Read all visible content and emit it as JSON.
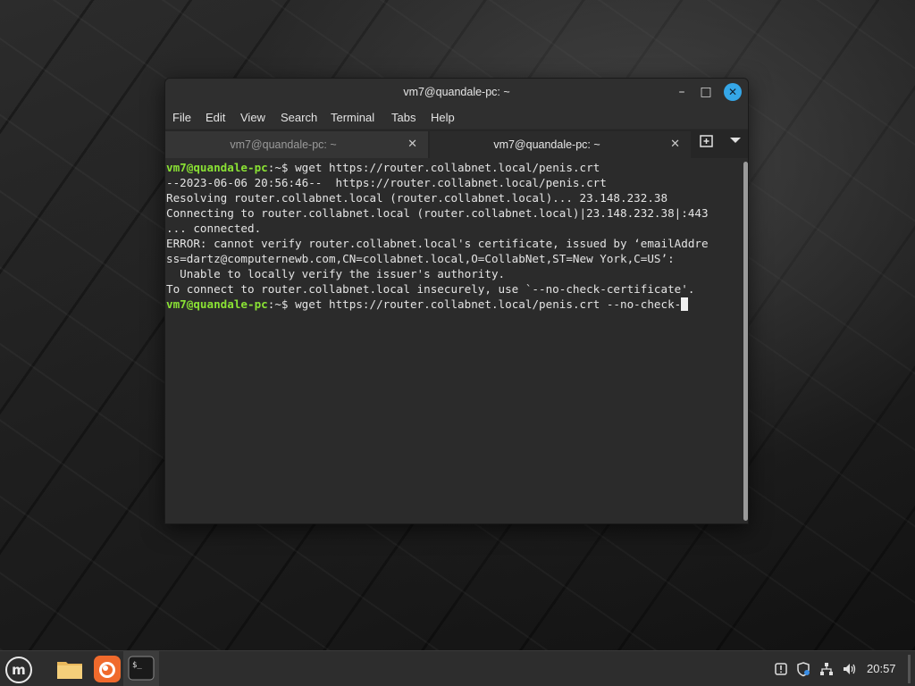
{
  "window": {
    "title": "vm7@quandale-pc: ~",
    "controls": {
      "minimize": "–",
      "maximize": "□",
      "close": "✕"
    }
  },
  "menu": [
    "File",
    "Edit",
    "View",
    "Search",
    "Terminal",
    "Tabs",
    "Help"
  ],
  "tabs": [
    {
      "label": "vm7@quandale-pc: ~",
      "active": false,
      "close": "✕"
    },
    {
      "label": "vm7@quandale-pc: ~",
      "active": true,
      "close": "✕"
    }
  ],
  "terminal": {
    "prompt_user": "vm7@quandale-pc",
    "prompt_suffix": ":~$ ",
    "lines": [
      {
        "prompt": true,
        "text": "wget https://router.collabnet.local/penis.crt"
      },
      {
        "prompt": false,
        "text": "--2023-06-06 20:56:46--  https://router.collabnet.local/penis.crt"
      },
      {
        "prompt": false,
        "text": "Resolving router.collabnet.local (router.collabnet.local)... 23.148.232.38"
      },
      {
        "prompt": false,
        "text": "Connecting to router.collabnet.local (router.collabnet.local)|23.148.232.38|:443"
      },
      {
        "prompt": false,
        "text": "... connected."
      },
      {
        "prompt": false,
        "text": "ERROR: cannot verify router.collabnet.local's certificate, issued by ‘emailAddre"
      },
      {
        "prompt": false,
        "text": "ss=dartz@computernewb.com,CN=collabnet.local,O=CollabNet,ST=New York,C=US’:"
      },
      {
        "prompt": false,
        "text": "  Unable to locally verify the issuer's authority."
      },
      {
        "prompt": false,
        "text": "To connect to router.collabnet.local insecurely, use `--no-check-certificate'."
      },
      {
        "prompt": true,
        "text": "wget https://router.collabnet.local/penis.crt --no-check-",
        "cursor": true
      }
    ]
  },
  "taskbar": {
    "clock": "20:57",
    "apps": [
      "menu-icon",
      "folder-icon",
      "firefox-icon",
      "terminal-icon"
    ],
    "tray": [
      "notification-icon",
      "shield-update-icon",
      "network-icon",
      "volume-icon"
    ]
  },
  "colors": {
    "prompt_green": "#8ae234",
    "close_button_blue": "#35a7e8"
  }
}
